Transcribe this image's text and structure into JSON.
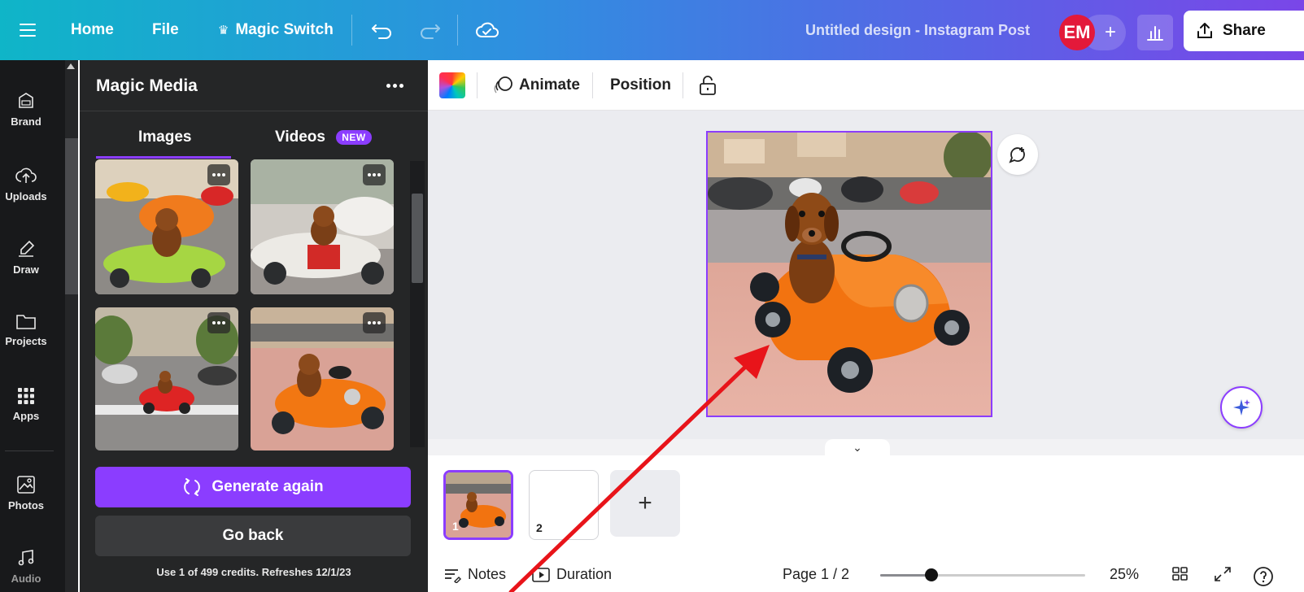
{
  "colors": {
    "accent": "#8b3dff",
    "panel_bg": "#252627",
    "rail_bg": "#18191b",
    "avatar_bg": "#e3193a",
    "annotation_arrow": "#e8141a"
  },
  "topbar": {
    "menu_icon": "hamburger-icon",
    "home": "Home",
    "file": "File",
    "magic_switch": "Magic Switch",
    "undo_icon": "undo-icon",
    "redo_icon": "redo-icon",
    "cloud_icon": "cloud-saved-icon",
    "document_title": "Untitled design - Instagram Post",
    "avatar_initials": "EM",
    "add_people": "+",
    "stats_icon": "chart-icon",
    "share": "Share"
  },
  "rail": {
    "items": [
      {
        "label": "Brand",
        "icon": "brand-icon"
      },
      {
        "label": "Uploads",
        "icon": "upload-icon"
      },
      {
        "label": "Draw",
        "icon": "draw-icon"
      },
      {
        "label": "Projects",
        "icon": "folder-icon"
      },
      {
        "label": "Apps",
        "icon": "apps-icon"
      },
      {
        "label": "Photos",
        "icon": "photo-icon"
      },
      {
        "label": "Audio",
        "icon": "music-icon"
      }
    ]
  },
  "panel": {
    "title": "Magic Media",
    "tabs": {
      "images": "Images",
      "videos": "Videos",
      "new_badge": "NEW"
    },
    "results": [
      {
        "alt": "Dachshund in green toy car, orange car behind"
      },
      {
        "alt": "Dachshund in white and red toy car"
      },
      {
        "alt": "Dachshund in red toy car on street"
      },
      {
        "alt": "Dachshund in orange toy car"
      }
    ],
    "generate_again": "Generate again",
    "go_back": "Go back",
    "credits": "Use 1 of 499 credits. Refreshes 12/1/23"
  },
  "context_bar": {
    "animate": "Animate",
    "position": "Position"
  },
  "pages": {
    "thumbs": [
      {
        "number": "1"
      },
      {
        "number": "2"
      }
    ],
    "add": "+"
  },
  "footer": {
    "notes": "Notes",
    "duration": "Duration",
    "page_indicator": "Page 1 / 2",
    "zoom": "25%",
    "zoom_level": 0.25
  }
}
